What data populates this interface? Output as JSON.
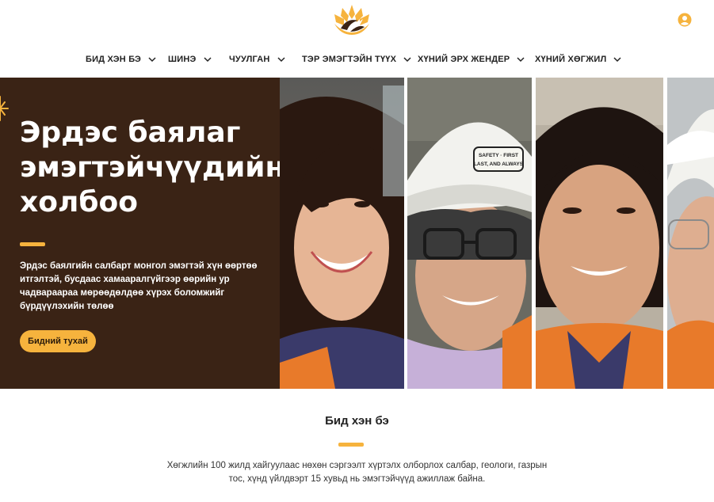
{
  "header": {
    "logo_icon": "lotus-logo-icon",
    "user_icon": "user-circle-icon",
    "accent_color": "#f6b33d"
  },
  "nav": {
    "items": [
      {
        "label": "БИД ХЭН БЭ"
      },
      {
        "label": "ШИНЭ"
      },
      {
        "label": "ЧУУЛГАН"
      },
      {
        "label": "ТЭР ЭМЭГТЭЙН ТҮҮХ"
      },
      {
        "label": "ХҮНИЙ ЭРХ ЖЕНДЕР"
      },
      {
        "label": "ХҮНИЙ ХӨГЖИЛ"
      }
    ],
    "dropdown_icon": "chevron-down-icon"
  },
  "hero": {
    "title_lines": [
      "Эрдэс баялаг",
      "эмэгтэйчүүдийн",
      "холбоо"
    ],
    "description_lines": [
      "Эрдэс баялгийн салбарт монгол эмэгтэй хүн өөртөө",
      "итгэлтэй, бусдаас хамааралгүйгээр өөрийн ур",
      "чадвараараа мөрөөдөлдөө хүрэх боломжийг",
      "бүрдүүлэхийн төлөө"
    ],
    "button_label": "Бидний тухай",
    "background_color": "#3a2315",
    "helmet_sticker_lines": [
      "SAFETY · FIRST",
      "LAST, AND ALWAYS"
    ]
  },
  "about": {
    "title": "Бид хэн бэ",
    "text_lines": [
      "Хөгжлийн 100 жилд хайгуулаас нөхөн сэргээлт хүртэлх олборлох салбар, геологи, газрын",
      "тос, хүнд үйлдвэрт 15 хувьд нь эмэгтэйчүүд ажиллаж байна."
    ]
  }
}
